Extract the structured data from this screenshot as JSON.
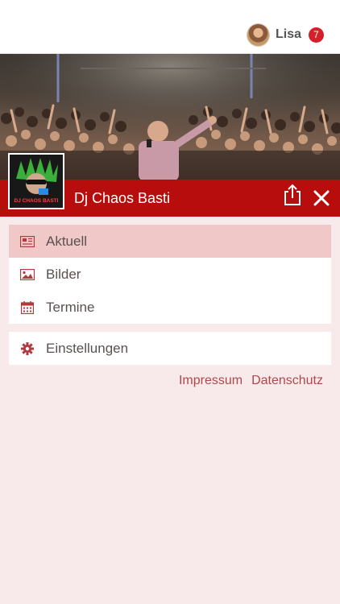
{
  "header": {
    "user_name": "Lisa",
    "notification_count": "7"
  },
  "profile": {
    "name": "Dj Chaos Basti",
    "logo_text": "DJ CHAOS BASTI"
  },
  "menu": {
    "items": [
      {
        "label": "Aktuell",
        "icon": "newspaper-icon",
        "active": true
      },
      {
        "label": "Bilder",
        "icon": "image-icon",
        "active": false
      },
      {
        "label": "Termine",
        "icon": "calendar-icon",
        "active": false
      }
    ],
    "settings_label": "Einstellungen"
  },
  "footer_links": {
    "impressum": "Impressum",
    "datenschutz": "Datenschutz"
  },
  "colors": {
    "accent": "#b80d0d",
    "active_row": "#f0c8c8",
    "background": "#f8eaea",
    "link": "#b0484c"
  }
}
